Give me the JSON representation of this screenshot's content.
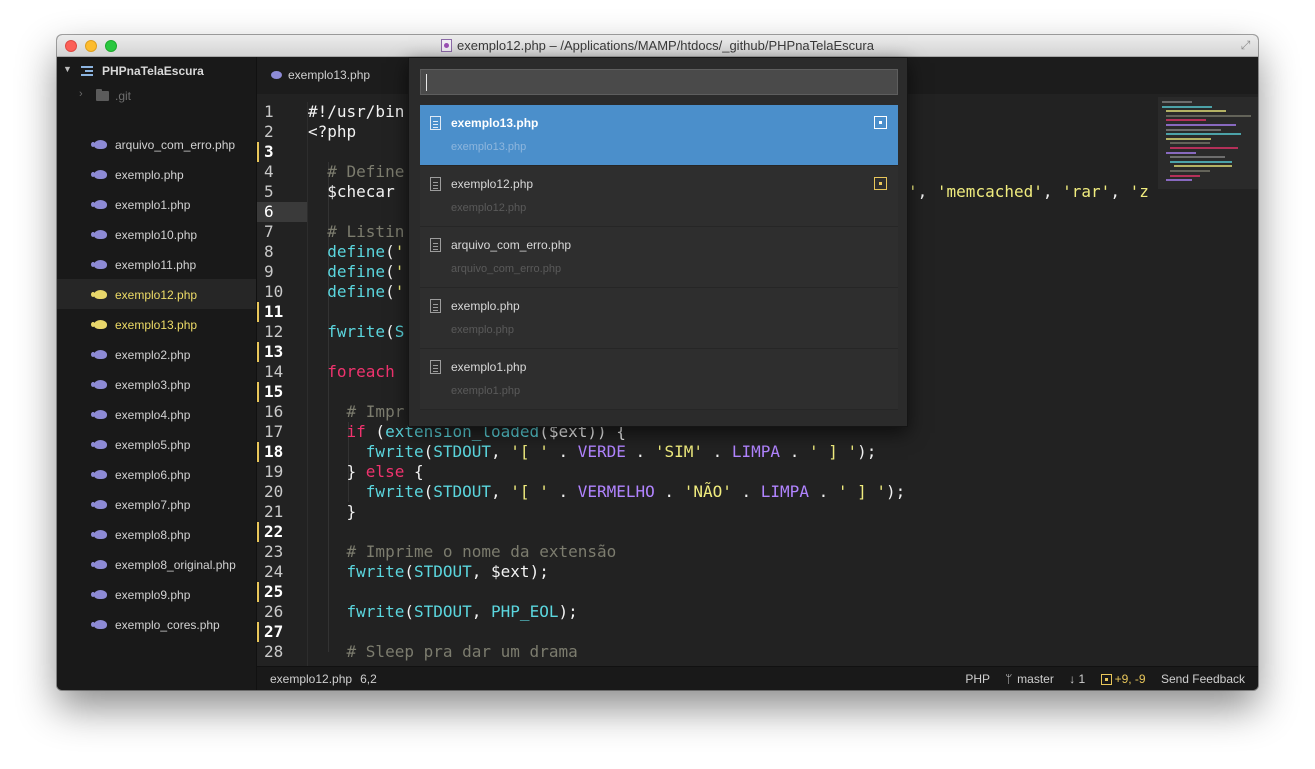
{
  "window": {
    "title": "exemplo12.php – /Applications/MAMP/htdocs/_github/PHPnaTelaEscura"
  },
  "sidebar": {
    "project": "PHPnaTelaEscura",
    "git_folder": ".git",
    "files": [
      {
        "label": "arquivo_com_erro.php",
        "modified": false,
        "active": false
      },
      {
        "label": "exemplo.php",
        "modified": false,
        "active": false
      },
      {
        "label": "exemplo1.php",
        "modified": false,
        "active": false
      },
      {
        "label": "exemplo10.php",
        "modified": false,
        "active": false
      },
      {
        "label": "exemplo11.php",
        "modified": false,
        "active": false
      },
      {
        "label": "exemplo12.php",
        "modified": true,
        "active": true
      },
      {
        "label": "exemplo13.php",
        "modified": true,
        "active": false
      },
      {
        "label": "exemplo2.php",
        "modified": false,
        "active": false
      },
      {
        "label": "exemplo3.php",
        "modified": false,
        "active": false
      },
      {
        "label": "exemplo4.php",
        "modified": false,
        "active": false
      },
      {
        "label": "exemplo5.php",
        "modified": false,
        "active": false
      },
      {
        "label": "exemplo6.php",
        "modified": false,
        "active": false
      },
      {
        "label": "exemplo7.php",
        "modified": false,
        "active": false
      },
      {
        "label": "exemplo8.php",
        "modified": false,
        "active": false
      },
      {
        "label": "exemplo8_original.php",
        "modified": false,
        "active": false
      },
      {
        "label": "exemplo9.php",
        "modified": false,
        "active": false
      },
      {
        "label": "exemplo_cores.php",
        "modified": false,
        "active": false
      }
    ]
  },
  "tabs": [
    {
      "label": "exemplo13.php"
    }
  ],
  "editor": {
    "line_numbers": [
      "1",
      "2",
      "3",
      "4",
      "5",
      "6",
      "7",
      "8",
      "9",
      "10",
      "11",
      "12",
      "13",
      "14",
      "15",
      "16",
      "17",
      "18",
      "19",
      "20",
      "21",
      "22",
      "23",
      "24",
      "25",
      "26",
      "27",
      "28"
    ],
    "current_line": 6,
    "modified_lines": [
      3,
      11,
      13,
      15,
      18,
      22,
      25,
      27
    ]
  },
  "quick_open": {
    "query": "",
    "items": [
      {
        "name": "exemplo13.php",
        "path": "exemplo13.php",
        "selected": true,
        "dirty": true
      },
      {
        "name": "exemplo12.php",
        "path": "exemplo12.php",
        "selected": false,
        "dirty": true
      },
      {
        "name": "arquivo_com_erro.php",
        "path": "arquivo_com_erro.php",
        "selected": false,
        "dirty": false
      },
      {
        "name": "exemplo.php",
        "path": "exemplo.php",
        "selected": false,
        "dirty": false
      },
      {
        "name": "exemplo1.php",
        "path": "exemplo1.php",
        "selected": false,
        "dirty": false
      }
    ]
  },
  "statusbar": {
    "file": "exemplo12.php",
    "cursor": "6,2",
    "language": "PHP",
    "branch": "master",
    "behind": "1",
    "diff": "+9, -9",
    "feedback": "Send Feedback"
  },
  "colors": {
    "selection": "#4b8fcb",
    "modified": "#e8c65a",
    "keyword": "#f0336e",
    "function": "#5bd6de",
    "string": "#f0ec7e",
    "constant": "#b184ff"
  }
}
